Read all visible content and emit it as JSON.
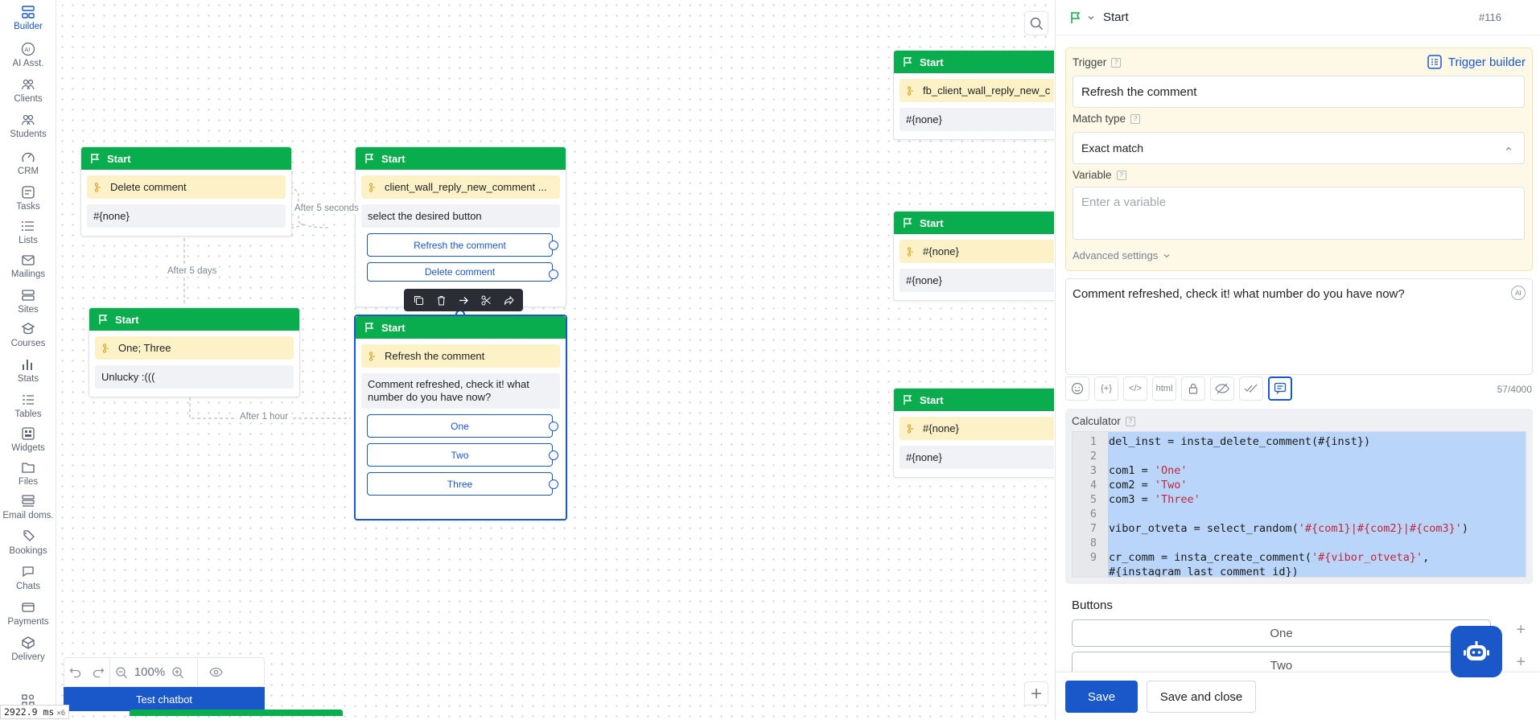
{
  "nav": [
    {
      "label": "Builder",
      "icon": "builder-icon",
      "active": true
    },
    {
      "label": "AI Asst.",
      "icon": "ai-icon"
    },
    {
      "label": "Clients",
      "icon": "clients-icon"
    },
    {
      "label": "Students",
      "icon": "students-icon"
    },
    {
      "label": "CRM",
      "icon": "crm-icon"
    },
    {
      "label": "Tasks",
      "icon": "tasks-icon"
    },
    {
      "label": "Lists",
      "icon": "lists-icon"
    },
    {
      "label": "Mailings",
      "icon": "mailings-icon"
    },
    {
      "label": "Sites",
      "icon": "sites-icon"
    },
    {
      "label": "Courses",
      "icon": "courses-icon"
    },
    {
      "label": "Stats",
      "icon": "stats-icon"
    },
    {
      "label": "Tables",
      "icon": "tables-icon"
    },
    {
      "label": "Widgets",
      "icon": "widgets-icon"
    },
    {
      "label": "Files",
      "icon": "files-icon"
    },
    {
      "label": "Email doms.",
      "icon": "email-domains-icon"
    },
    {
      "label": "Bookings",
      "icon": "bookings-icon"
    },
    {
      "label": "Chats",
      "icon": "chats-icon"
    },
    {
      "label": "Payments",
      "icon": "payments-icon"
    },
    {
      "label": "Delivery",
      "icon": "delivery-icon"
    }
  ],
  "canvas": {
    "nodes": {
      "n1": {
        "title": "Start",
        "trigger": "Delete comment",
        "message": "#{none}"
      },
      "n2": {
        "title": "Start",
        "trigger": "client_wall_reply_new_comment ...",
        "message": "select the desired button",
        "buttons": [
          "Refresh the comment",
          "Delete comment"
        ]
      },
      "n3": {
        "title": "Start",
        "trigger": "One; Three",
        "message": "Unlucky :((("
      },
      "n4": {
        "title": "Start",
        "trigger": "Refresh the comment",
        "message": "Comment refreshed, check it! what number do you have now?",
        "buttons": [
          "One",
          "Two",
          "Three"
        ]
      },
      "n5": {
        "title": "Start",
        "trigger": "fb_client_wall_reply_new_c",
        "message": "#{none}"
      },
      "n6": {
        "title": "Start",
        "trigger": "#{none}",
        "message": "#{none}"
      },
      "n7": {
        "title": "Start",
        "trigger": "#{none}",
        "message": "#{none}"
      }
    },
    "edges": {
      "after5s": "After 5 seconds",
      "after5d": "After 5 days",
      "after1h": "After 1 hour"
    },
    "zoom": "100%",
    "test_button": "Test chatbot",
    "perf": {
      "value": "2922.9",
      "unit": "ms",
      "mult": "×6"
    }
  },
  "panel": {
    "title": "Start",
    "id": "#116",
    "trigger_label": "Trigger",
    "trigger_builder": "Trigger builder",
    "trigger_value": "Refresh the comment",
    "match_type_label": "Match type",
    "match_type_value": "Exact match",
    "variable_label": "Variable",
    "variable_placeholder": "Enter a variable",
    "advanced": "Advanced settings",
    "message": "Comment refreshed, check it! what number do you have now?",
    "ai_badge": "AI",
    "format_html": "html",
    "counter": "57/4000",
    "calculator_label": "Calculator",
    "code": [
      {
        "n": "1",
        "pre": "del_inst = insta_delete_comment(#{inst})",
        "str": "",
        "post": ""
      },
      {
        "n": "2",
        "pre": "",
        "str": "",
        "post": ""
      },
      {
        "n": "3",
        "pre": "com1 = ",
        "str": "'One'",
        "post": ""
      },
      {
        "n": "4",
        "pre": "com2 = ",
        "str": "'Two'",
        "post": ""
      },
      {
        "n": "5",
        "pre": "com3 = ",
        "str": "'Three'",
        "post": ""
      },
      {
        "n": "6",
        "pre": "",
        "str": "",
        "post": ""
      },
      {
        "n": "7",
        "pre": "vibor_otveta = select_random(",
        "str": "'#{com1}|#{com2}|#{com3}'",
        "post": ")"
      },
      {
        "n": "8",
        "pre": "",
        "str": "",
        "post": ""
      },
      {
        "n": "9",
        "pre": "cr_comm = insta_create_comment(",
        "str": "'#{vibor_otveta}'",
        "post": ","
      },
      {
        "n": "",
        "pre": "#{instagram_last_comment_id})",
        "str": "",
        "post": ""
      }
    ],
    "buttons_label": "Buttons",
    "buttons": [
      "One",
      "Two"
    ],
    "save": "Save",
    "save_close": "Save and close"
  }
}
